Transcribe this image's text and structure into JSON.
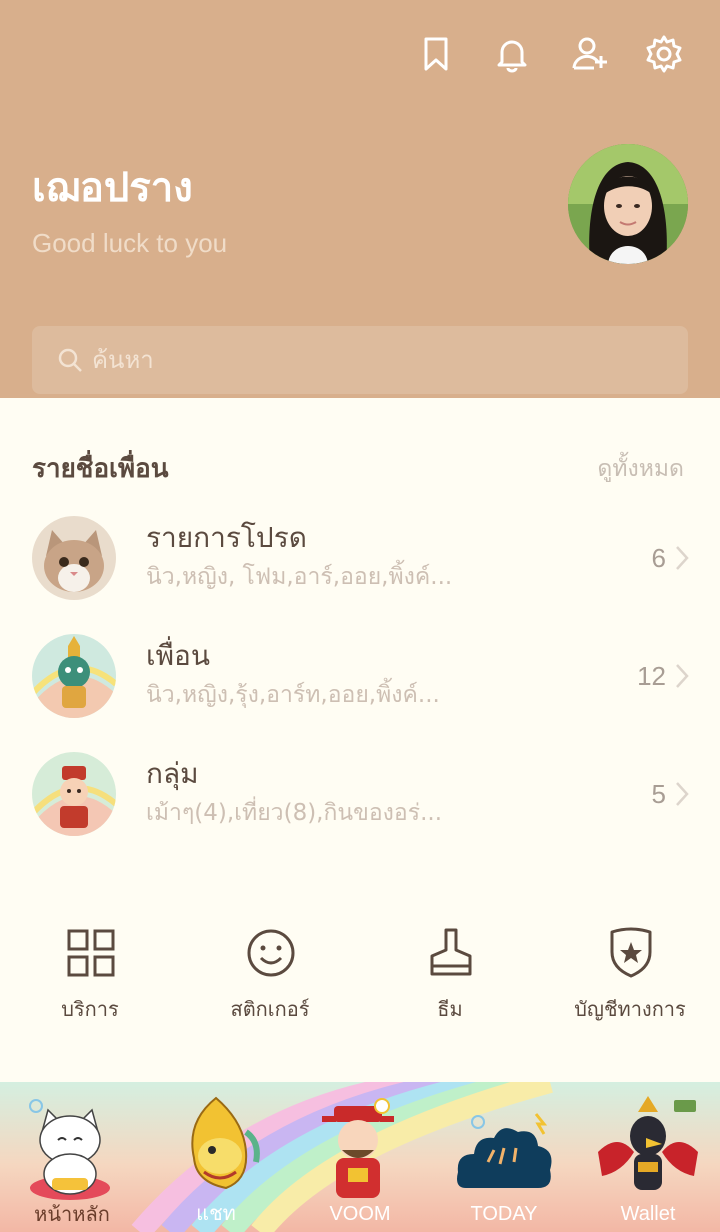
{
  "colors": {
    "header_bg": "#d8af8c",
    "body_bg": "#fffdf3",
    "text_dark": "#5b4a3f",
    "text_muted": "#cdbfb3"
  },
  "header": {
    "icons": [
      "bookmark-icon",
      "bell-icon",
      "add-friend-icon",
      "settings-icon"
    ],
    "profile_name": "เฌอปราง",
    "status_message": "Good luck to you",
    "search_placeholder": "ค้นหา"
  },
  "friends_section": {
    "title": "รายชื่อเพื่อน",
    "see_all": "ดูทั้งหมด",
    "rows": [
      {
        "title": "รายการโปรด",
        "subtitle": "นิว,หญิง, โฟม,อาร์,ออย,พิ้งค์...",
        "count": "6"
      },
      {
        "title": "เพื่อน",
        "subtitle": "นิว,หญิง,รุ้ง,อาร์ท,ออย,พิ้งค์...",
        "count": "12"
      },
      {
        "title": "กลุ่ม",
        "subtitle": "เม้าๆ(4),เที่ยว(8),กินของอร่...",
        "count": "5"
      }
    ]
  },
  "shortcuts": [
    {
      "label": "บริการ",
      "icon": "grid-icon"
    },
    {
      "label": "สติกเกอร์",
      "icon": "smiley-icon"
    },
    {
      "label": "ธีม",
      "icon": "brush-icon"
    },
    {
      "label": "บัญชีทางการ",
      "icon": "shield-star-icon"
    }
  ],
  "tabs": [
    {
      "label": "หน้าหลัก",
      "active": true,
      "icon": "lucky-cat-icon"
    },
    {
      "label": "แชท",
      "active": false,
      "icon": "naga-icon"
    },
    {
      "label": "VOOM",
      "active": false,
      "icon": "god-of-wealth-icon"
    },
    {
      "label": "TODAY",
      "active": false,
      "icon": "pine-cloud-icon"
    },
    {
      "label": "Wallet",
      "active": false,
      "icon": "garuda-icon"
    }
  ]
}
